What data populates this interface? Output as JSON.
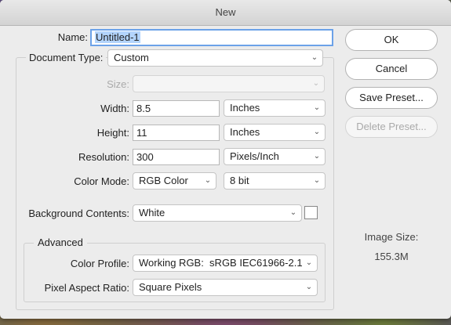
{
  "window": {
    "title": "New"
  },
  "form": {
    "name_label": "Name:",
    "name_value": "Untitled-1",
    "doc_type_label": "Document Type:",
    "doc_type_value": "Custom",
    "size_label": "Size:",
    "size_value": "",
    "width_label": "Width:",
    "width_value": "8.5",
    "width_unit": "Inches",
    "height_label": "Height:",
    "height_value": "11",
    "height_unit": "Inches",
    "resolution_label": "Resolution:",
    "resolution_value": "300",
    "resolution_unit": "Pixels/Inch",
    "color_mode_label": "Color Mode:",
    "color_mode_value": "RGB Color",
    "bit_depth_value": "8 bit",
    "bg_contents_label": "Background Contents:",
    "bg_contents_value": "White",
    "bg_swatch_color": "#ffffff"
  },
  "advanced": {
    "legend": "Advanced",
    "color_profile_label": "Color Profile:",
    "color_profile_value": "Working RGB:  sRGB IEC61966-2.1",
    "pixel_aspect_label": "Pixel Aspect Ratio:",
    "pixel_aspect_value": "Square Pixels"
  },
  "buttons": {
    "ok": "OK",
    "cancel": "Cancel",
    "save_preset": "Save Preset...",
    "delete_preset": "Delete Preset..."
  },
  "image_size": {
    "label": "Image Size:",
    "value": "155.3M"
  }
}
